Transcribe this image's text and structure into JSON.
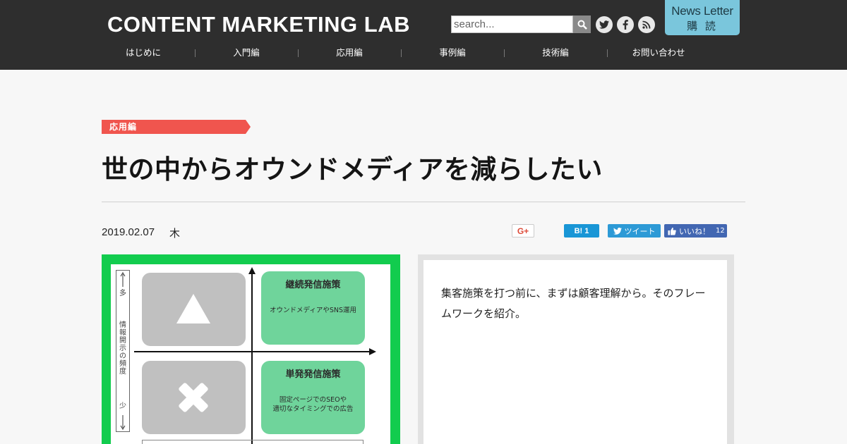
{
  "header": {
    "logo": "CONTENT MARKETING LAB",
    "search_placeholder": "search...",
    "search_icon": "search-icon",
    "social_icons": [
      "twitter-icon",
      "facebook-icon",
      "rss-icon"
    ],
    "newsletter": {
      "line1": "News Letter",
      "line2": "購 読"
    }
  },
  "nav": {
    "items": [
      "はじめに",
      "入門編",
      "応用編",
      "事例編",
      "技術編",
      "お問い合わせ"
    ]
  },
  "article": {
    "category": "応用編",
    "title": "世の中からオウンドメディアを減らしたい",
    "date": "2019.02.07",
    "author": "木"
  },
  "share": {
    "gplus": "G+",
    "hatena": "B! 1",
    "tweet": "ツイート",
    "like_label": "いいね！",
    "like_count": "12"
  },
  "figure": {
    "axis_top": "多",
    "axis_label": "情報開示の頻度",
    "axis_bottom": "少",
    "top_left_symbol": "triangle",
    "bottom_left_symbol": "cross",
    "q1_title": "継続発信施策",
    "q1_desc": "オウンドメディアやSNS運用",
    "q4_title": "単発発信施策",
    "q4_desc_line1": "固定ページでのSEOや",
    "q4_desc_line2": "適切なタイミングでの広告"
  },
  "panel": {
    "text": "集客施策を打つ前に、まずは顧客理解から。そのフレームワークを紹介。"
  },
  "colors": {
    "header_bg": "#2e2e2e",
    "accent_red": "#f0554e",
    "newsletter_bg": "#7ac6dc",
    "figure_green": "#12cc4e",
    "quadrant_green": "#6fd49b"
  }
}
